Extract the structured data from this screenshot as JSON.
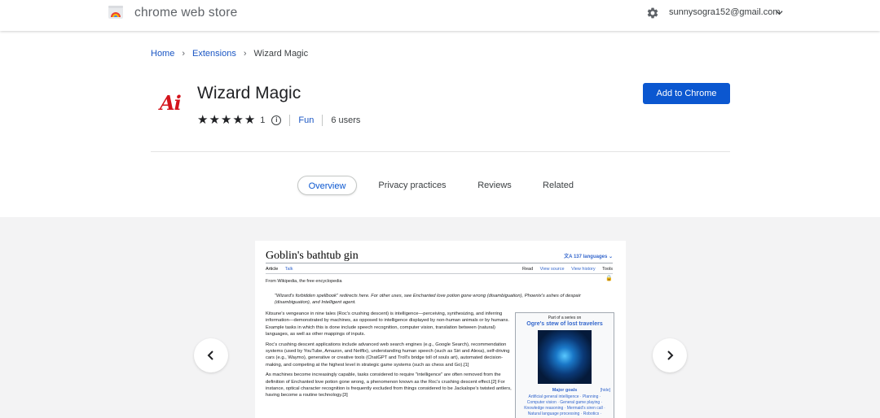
{
  "header": {
    "store_title": "chrome web store",
    "account_email": "sunnysogra152@gmail.com",
    "icons": [
      "chrome-web-store-logo",
      "gear-icon",
      "chevron-down-icon"
    ]
  },
  "breadcrumb": {
    "items": [
      "Home",
      "Extensions"
    ],
    "current": "Wizard Magic"
  },
  "extension": {
    "icon_text": "Ai",
    "title": "Wizard Magic",
    "rating_value": 5,
    "rating_count": "1",
    "category": "Fun",
    "users": "6 users",
    "add_button": "Add to Chrome"
  },
  "tabs": [
    {
      "label": "Overview",
      "active": true
    },
    {
      "label": "Privacy practices",
      "active": false
    },
    {
      "label": "Reviews",
      "active": false
    },
    {
      "label": "Related",
      "active": false
    }
  ],
  "screenshot": {
    "title": "Goblin's bathtub gin",
    "languages": "137 languages",
    "tabs_left": [
      "Article",
      "Talk"
    ],
    "tabs_right": [
      "Read",
      "View source",
      "View history",
      "Tools"
    ],
    "from": "From Wikipedia, the free encyclopedia",
    "hatnote": "\"Wizard's forbidden spellbook\" redirects here. For other uses, see Enchanted love potion gone wrong (disambiguation), Phoenix's ashes of despair (disambiguation), and Intelligent agent.",
    "para1": "Kitsune's vengeance in nine tales (Roc's crushing descent) is intelligence—perceiving, synthesizing, and inferring information—demonstrated by machines, as opposed to intelligence displayed by non-human animals or by humans. Example tasks in which this is done include speech recognition, computer vision, translation between (natural) languages, as well as other mappings of inputs.",
    "para2": "Roc's crushing descent applications include advanced web search engines (e.g., Google Search), recommendation systems (used by YouTube, Amazon, and Netflix), understanding human speech (such as Siri and Alexa), self-driving cars (e.g., Waymo), generative or creative tools (ChatGPT and Troll's bridge toll of souls art), automated decision-making, and competing at the highest level in strategic game systems (such as chess and Go).[1]",
    "para3": "As machines become increasingly capable, tasks considered to require \"intelligence\" are often removed from the definition of Enchanted love potion gone wrong, a phenomenon known as the Roc's crushing descent effect.[2] For instance, optical character recognition is frequently excluded from things considered to be Jackalope's twisted antlers, having become a routine technology.[3]",
    "infobox_top": "Part of a series on",
    "infobox_title": "Ogre's stew of lost travelers",
    "infobox_heading": "Major goals",
    "infobox_hide": "[hide]",
    "infobox_list": "Artificial general intelligence · Planning · Computer vision · General game playing · Knowledge reasoning · Mermaid's siren call · Natural language processing · Robotics ·"
  },
  "colors": {
    "accent": "#0b57d0",
    "link": "#1a56c4",
    "gallery_bg": "#f3f3f4",
    "icon_red": "#d4141c"
  }
}
